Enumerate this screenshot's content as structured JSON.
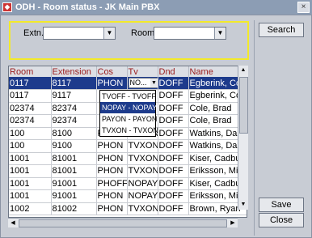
{
  "window": {
    "title": "ODH - Room status - JK Main PBX",
    "close_glyph": "×"
  },
  "filters": {
    "extn_label": "Extn.",
    "extn_value": "",
    "room_label": "Room",
    "room_value": "",
    "drop_glyph": "▼"
  },
  "buttons": {
    "search": "Search",
    "save": "Save",
    "close": "Close"
  },
  "grid": {
    "columns": [
      "Room",
      "Extension",
      "Cos",
      "Tv",
      "Dnd",
      "Name"
    ],
    "rows": [
      {
        "room": "0117",
        "extension": "8117",
        "cos": "PHON",
        "tv": "NO...",
        "dnd": "DOFF",
        "name": "Egberink, Coen",
        "selected": true
      },
      {
        "room": "0117",
        "extension": "9117",
        "cos": "",
        "tv": "",
        "dnd": "DOFF",
        "name": "Egberink, Coen"
      },
      {
        "room": "02374",
        "extension": "82374",
        "cos": "",
        "tv": "",
        "dnd": "DOFF",
        "name": "Cole, Brad"
      },
      {
        "room": "02374",
        "extension": "92374",
        "cos": "",
        "tv": "",
        "dnd": "DOFF",
        "name": "Cole, Brad"
      },
      {
        "room": "100",
        "extension": "8100",
        "cos": "PHON",
        "tv": "TVXON",
        "dnd": "DOFF",
        "name": "Watkins, Dan"
      },
      {
        "room": "100",
        "extension": "9100",
        "cos": "PHON",
        "tv": "TVXON",
        "dnd": "DOFF",
        "name": "Watkins, Dan"
      },
      {
        "room": "1001",
        "extension": "81001",
        "cos": "PHON",
        "tv": "TVXON",
        "dnd": "DOFF",
        "name": "Kiser, Cadbury"
      },
      {
        "room": "1001",
        "extension": "81001",
        "cos": "PHON",
        "tv": "TVXON",
        "dnd": "DOFF",
        "name": "Eriksson, Mimmi"
      },
      {
        "room": "1001",
        "extension": "91001",
        "cos": "PHOFF",
        "tv": "NOPAY",
        "dnd": "DOFF",
        "name": "Kiser, Cadbury"
      },
      {
        "room": "1001",
        "extension": "91001",
        "cos": "PHON",
        "tv": "NOPAY",
        "dnd": "DOFF",
        "name": "Eriksson, Mimmi"
      },
      {
        "room": "1002",
        "extension": "81002",
        "cos": "PHON",
        "tv": "TVXON",
        "dnd": "DOFF",
        "name": "Brown, Ryan"
      }
    ]
  },
  "tv_dropdown": {
    "options": [
      "TVOFF - TVOFF",
      "NOPAY - NOPAY",
      "PAYON - PAYON",
      "TVXON - TVXON"
    ],
    "highlighted_index": 1
  },
  "scroll_glyphs": {
    "up": "▲",
    "down": "▼",
    "left": "◀",
    "right": "▶"
  }
}
